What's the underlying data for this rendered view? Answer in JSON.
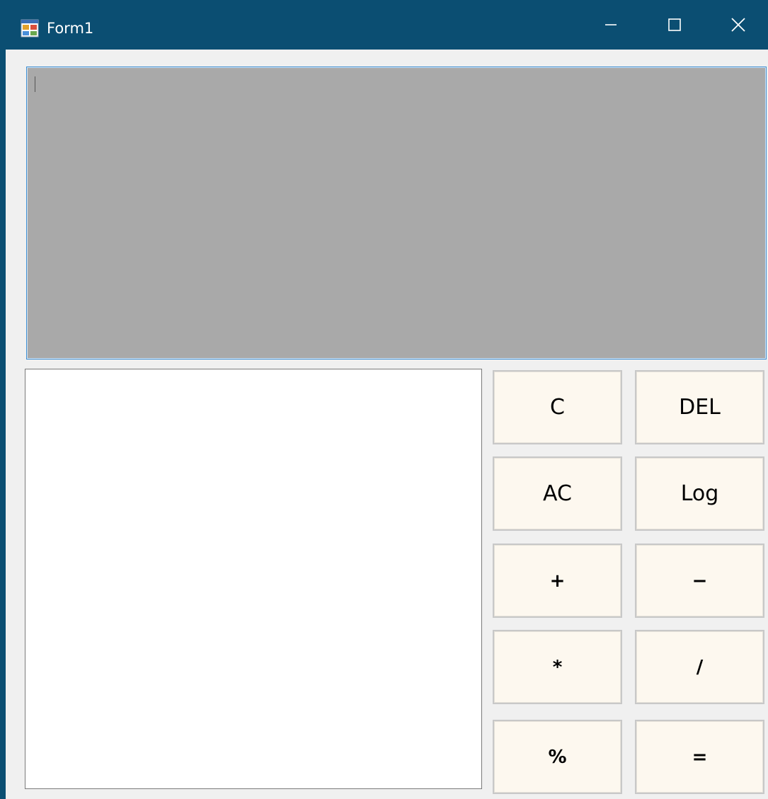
{
  "window": {
    "title": "Form1",
    "icon": "winforms-app-icon",
    "controls": {
      "minimize": "minimize-icon",
      "maximize": "maximize-icon",
      "close": "close-icon"
    }
  },
  "display": {
    "value": ""
  },
  "history": {
    "items": []
  },
  "buttons": {
    "c": "C",
    "del": "DEL",
    "ac": "AC",
    "log": "Log",
    "plus": "+",
    "minus": "−",
    "multiply": "*",
    "divide": "/",
    "percent": "%",
    "equals": "="
  },
  "colors": {
    "titlebar": "#0b4e72",
    "display_bg": "#a9a9a9",
    "button_bg": "#fdf8ef",
    "window_bg": "#f0f0f0"
  }
}
